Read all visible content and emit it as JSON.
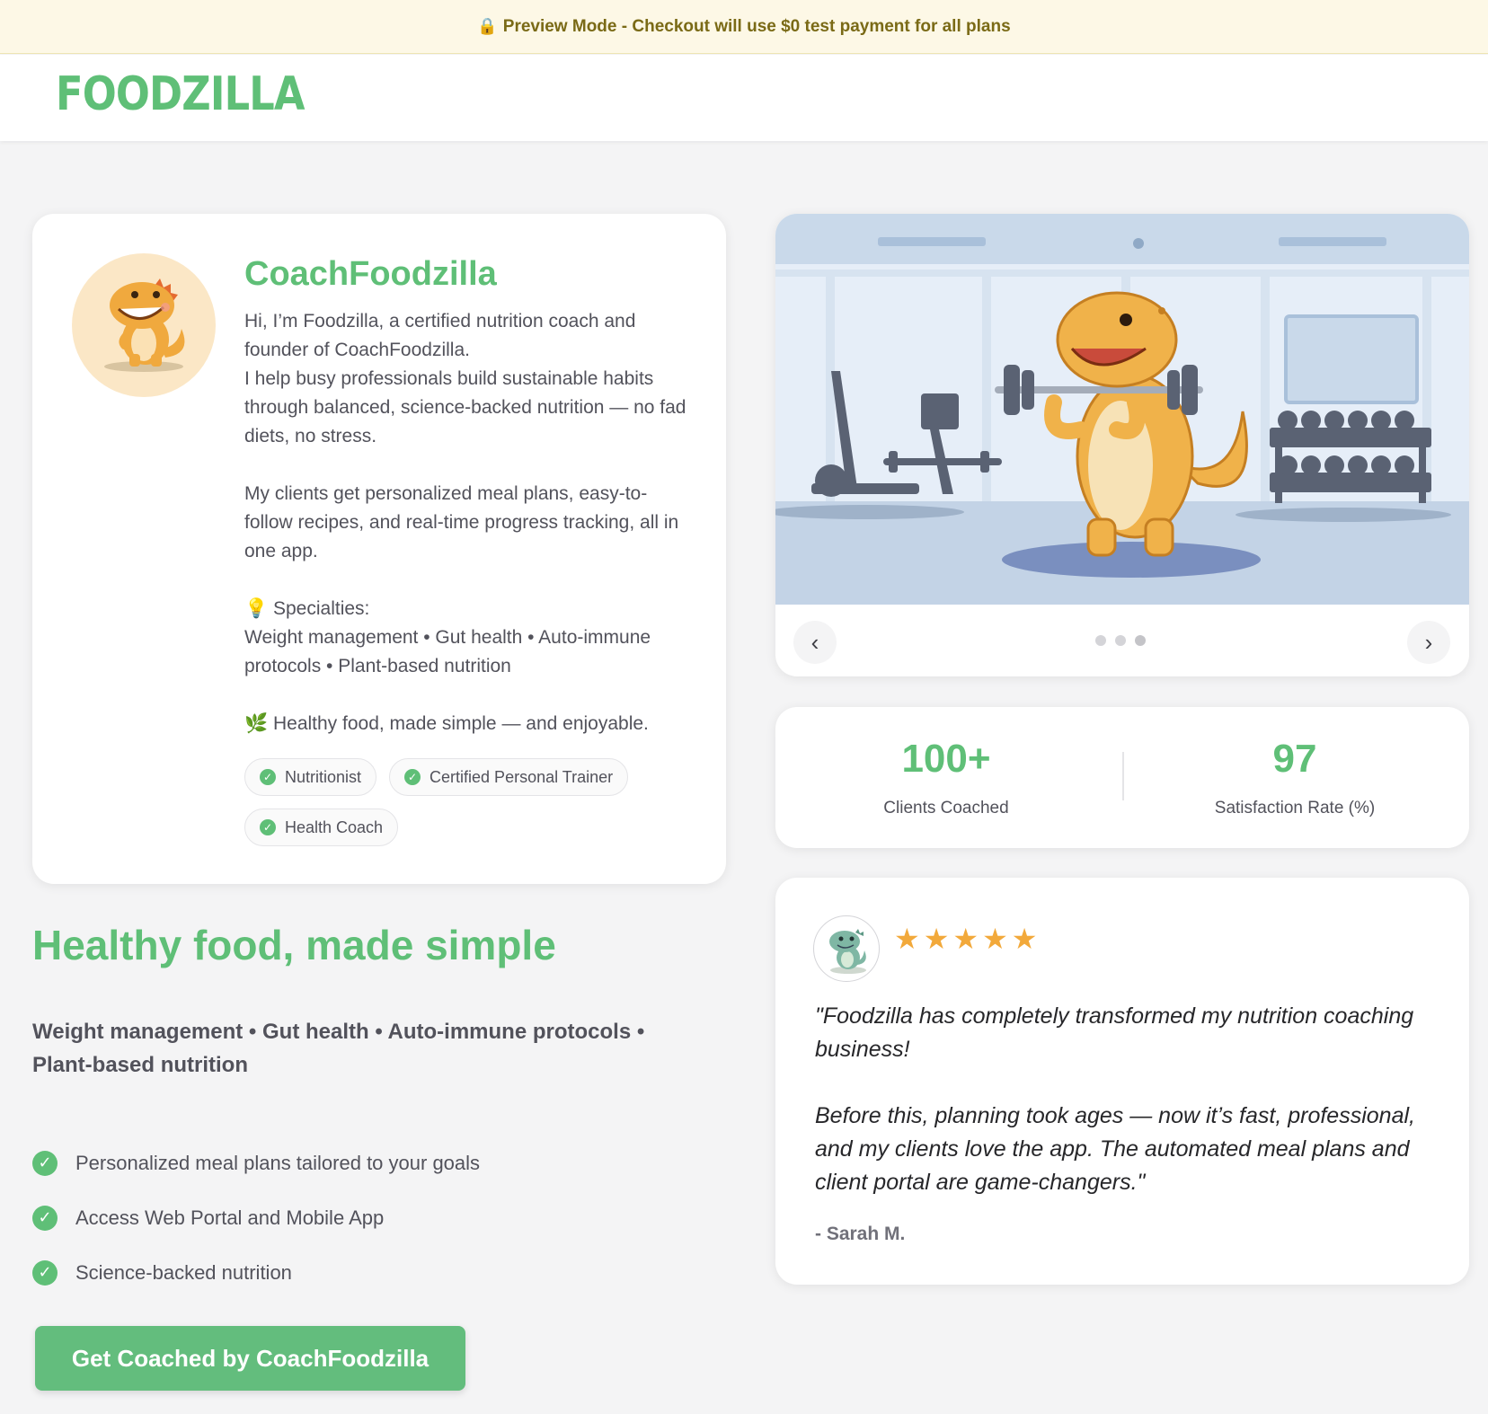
{
  "banner": {
    "lock_icon": "🔒",
    "text": "Preview Mode - Checkout will use $0 test payment for all plans"
  },
  "header": {
    "logo": "FOODZILLA"
  },
  "profile": {
    "name": "CoachFoodzilla",
    "bio": [
      "Hi, I’m Foodzilla, a certified nutrition coach and founder of CoachFoodzilla.",
      "I help busy professionals build sustainable habits through balanced, science-backed nutrition — no fad diets, no stress.",
      "",
      "My clients get personalized meal plans, easy-to-follow recipes, and real-time progress tracking, all in one app.",
      "",
      "💡 Specialties:",
      "Weight management • Gut health • Auto-immune protocols • Plant-based nutrition",
      "",
      "🌿 Healthy food, made simple — and enjoyable."
    ],
    "badges": [
      "Nutritionist",
      "Certified Personal Trainer",
      "Health Coach"
    ]
  },
  "hero": {
    "headline": "Healthy food, made simple",
    "specialties": "Weight management • Gut health • Auto-immune protocols • Plant-based nutrition",
    "features": [
      "Personalized meal plans tailored to your goals",
      "Access Web Portal and Mobile App",
      "Science-backed nutrition"
    ],
    "cta_label": "Get Coached by CoachFoodzilla"
  },
  "carousel": {
    "prev_icon": "‹",
    "next_icon": "›",
    "slide_count": 3,
    "active_slide": 3
  },
  "stats": [
    {
      "value": "100+",
      "label": "Clients Coached"
    },
    {
      "value": "97",
      "label": "Satisfaction Rate (%)"
    }
  ],
  "review": {
    "rating": 5,
    "star": "★",
    "quote": [
      "\"Foodzilla has completely transformed my nutrition coaching business!",
      "",
      "Before this, planning took ages — now it’s fast, professional, and my clients love the app. The automated meal plans and client portal are game-changers.\""
    ],
    "author": "- Sarah M."
  },
  "colors": {
    "brand_green": "#5fbf77",
    "banner_bg": "#fdf8e6",
    "banner_text": "#7a6a16",
    "star": "#f2a93b"
  }
}
